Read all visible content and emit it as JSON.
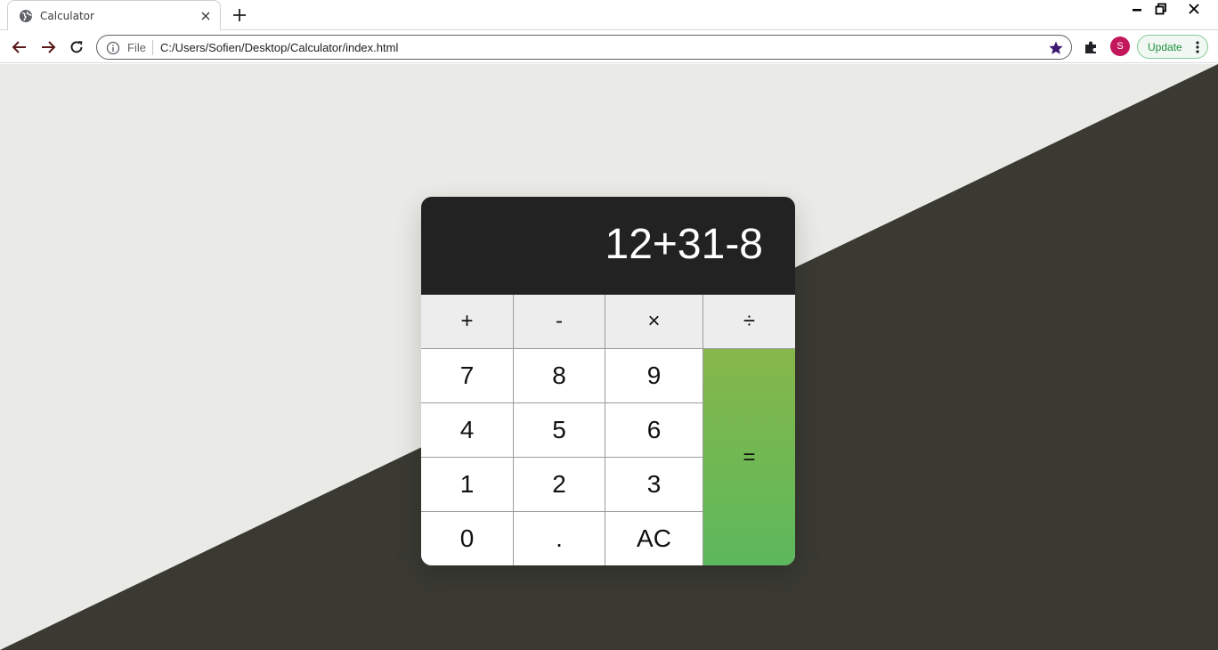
{
  "browser": {
    "tab_title": "Calculator",
    "new_tab_symbol": "+",
    "address": {
      "scheme_label": "File",
      "url": "C:/Users/Sofien/Desktop/Calculator/index.html"
    },
    "profile_initial": "S",
    "update_label": "Update",
    "icons": [
      "globe-icon",
      "close-icon",
      "plus-icon",
      "minimize-icon",
      "restore-icon",
      "window-close-icon",
      "back-arrow-icon",
      "forward-arrow-icon",
      "reload-icon",
      "info-icon",
      "star-icon",
      "puzzle-icon",
      "more-vert-icon"
    ]
  },
  "colors": {
    "page_light": "#eaeae6",
    "page_dark": "#3a3a33",
    "display_bg": "#222222",
    "operator_bg": "#ededed",
    "equals_top": "#86b74a",
    "equals_bottom": "#5cb85c",
    "star": "#3c1a6e"
  },
  "calculator": {
    "display_value": "12+31-8",
    "operators": {
      "add": "+",
      "subtract": "-",
      "multiply": "×",
      "divide": "÷"
    },
    "digits": {
      "d7": "7",
      "d8": "8",
      "d9": "9",
      "d4": "4",
      "d5": "5",
      "d6": "6",
      "d1": "1",
      "d2": "2",
      "d3": "3",
      "d0": "0"
    },
    "decimal": ".",
    "clear": "AC",
    "equals": "="
  }
}
